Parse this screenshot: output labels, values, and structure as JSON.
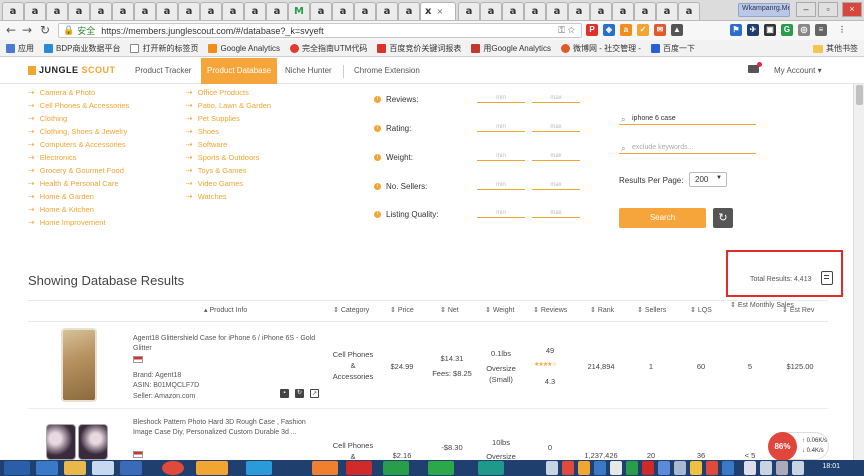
{
  "browser": {
    "tabs": [
      "a",
      "a",
      "a",
      "a",
      "a",
      "a",
      "a",
      "a",
      "a",
      "a",
      "a",
      "a",
      "a",
      "M",
      "a",
      "a",
      "a",
      "a",
      "a",
      "x",
      "a",
      "a",
      "a",
      "a",
      "a",
      "a",
      "a",
      "a",
      "a",
      "a",
      "a"
    ],
    "active_tab_close": "×",
    "profile": "Wkampanrg.Me",
    "address": {
      "secure_label": "安全",
      "url": "https://members.junglescout.com/#/database?_k=svyeft"
    },
    "bookmarks": [
      {
        "label": "应用",
        "color": "#4a7bd0"
      },
      {
        "label": "BDP商业数据平台",
        "color": "#2b8ad8"
      },
      {
        "label": "打开新的标签页",
        "color": "#888888"
      },
      {
        "label": "Google Analytics",
        "color": "#f28c1b"
      },
      {
        "label": "完全指南UTM代码",
        "color": "#e23a2e"
      },
      {
        "label": "百度竞价关键词报表",
        "color": "#d9342a"
      },
      {
        "label": "用Google Analytics",
        "color": "#c0392b"
      },
      {
        "label": "微博网 - 社交管理 -",
        "color": "#e05a2b"
      },
      {
        "label": "百度一下",
        "color": "#2a5fd8"
      }
    ],
    "other_bookmarks": "其他书签"
  },
  "header": {
    "logo_a": "JUNGLE",
    "logo_b": "SCOUT",
    "nav": [
      {
        "label": "Product Tracker",
        "active": false
      },
      {
        "label": "Product Database",
        "active": true
      },
      {
        "label": "Niche Hunter",
        "active": false
      },
      {
        "label": "Chrome Extension",
        "active": false
      }
    ],
    "account": "My Account"
  },
  "categories_col1": [
    "Camera & Photo",
    "Cell Phones & Accessories",
    "Clothing",
    "Clothing, Shoes & Jewelry",
    "Computers & Accessories",
    "Electronics",
    "Grocery & Gourmet Food",
    "Health & Personal Care",
    "Home & Garden",
    "Home & Kitchen",
    "Home Improvement"
  ],
  "categories_col2": [
    "Office Products",
    "Patio, Lawn & Garden",
    "Pet Supplies",
    "Shoes",
    "Software",
    "Sports & Outdoors",
    "Toys & Games",
    "Video Games",
    "Watches"
  ],
  "filters": {
    "rows": [
      "Reviews:",
      "Rating:",
      "Weight:",
      "No. Sellers:",
      "Listing Quality:"
    ],
    "min_placeholder": "min",
    "max_placeholder": "max"
  },
  "keyword": {
    "value": "iphone 6 case",
    "exclude_placeholder": "exclude keywords..."
  },
  "results_per_page": {
    "label": "Results Per Page:",
    "value": "200"
  },
  "search_label": "Search",
  "reset_icon": "↻",
  "results": {
    "title": "Showing Database Results",
    "total": "Total Results: 4,413"
  },
  "columns": [
    "Product Info",
    "Category",
    "Price",
    "Net",
    "Weight",
    "Reviews",
    "Rank",
    "Sellers",
    "LQS",
    "Est Monthly Sales",
    "Est Rev"
  ],
  "products": [
    {
      "title": "Agent18 Glittershield Case for iPhone 6 / iPhone 6S - Gold Glitter",
      "flag": "US",
      "brand": "Brand: Agent18",
      "asin": "ASIN: B01MQCLF7D",
      "seller": "Seller: Amazon.com",
      "category": "Cell Phones & Accessories",
      "price": "$24.99",
      "net": "$14.31",
      "fees": "Fees: $8.25",
      "weight": "0.1lbs",
      "size": "Oversize (Small)",
      "reviews": "49",
      "rating": "4.3",
      "rank": "214,894",
      "sellers": "1",
      "lqs": "60",
      "sales": "5",
      "rev": "$125.00"
    },
    {
      "title": "Bleshock Pattern Photo Hard 3D Rough Case , Fashion Image Case Diy, Personalized Custom Durable 3d ...",
      "flag": "US",
      "category": "Cell Phones &",
      "price": "$2.16",
      "net": "-$8.30",
      "weight": "10lbs",
      "size": "Oversize",
      "reviews": "0",
      "rank": "1,237,426",
      "sellers": "20",
      "lqs": "36",
      "sales": "< 5",
      "rev": "-"
    }
  ],
  "status": {
    "cpu": "86%",
    "up": "0.06K/s",
    "down": "0.4K/s",
    "time": "18:01"
  }
}
